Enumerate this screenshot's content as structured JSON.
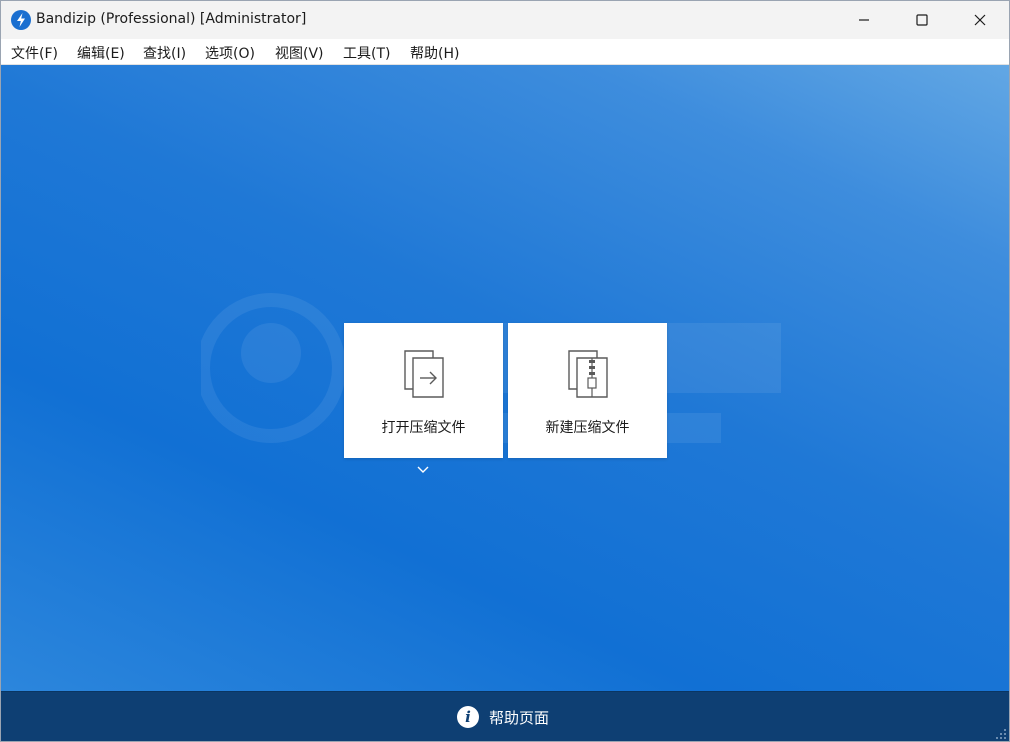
{
  "window": {
    "title": "Bandizip (Professional) [Administrator]",
    "icon": "bandizip-logo-icon"
  },
  "titlebar_controls": {
    "minimize_icon": "minimize-icon",
    "maximize_icon": "maximize-icon",
    "close_icon": "close-icon"
  },
  "menu": {
    "items": [
      {
        "id": "file",
        "label": "文件(F)"
      },
      {
        "id": "edit",
        "label": "编辑(E)"
      },
      {
        "id": "find",
        "label": "查找(I)"
      },
      {
        "id": "options",
        "label": "选项(O)"
      },
      {
        "id": "view",
        "label": "视图(V)"
      },
      {
        "id": "tools",
        "label": "工具(T)"
      },
      {
        "id": "help",
        "label": "帮助(H)"
      }
    ]
  },
  "tiles": {
    "open_archive": {
      "label": "打开压缩文件",
      "icon": "open-archive-icon"
    },
    "new_archive": {
      "label": "新建压缩文件",
      "icon": "zip-file-icon"
    }
  },
  "open_dropdown_icon": "chevron-down-icon",
  "help_bar": {
    "label": "帮助页面",
    "icon": "info-icon",
    "icon_glyph": "i"
  },
  "colors": {
    "content_gradient_start": "#62a7e4",
    "content_gradient_end": "#1170d4",
    "help_bar": "#0e3f73",
    "accent": "#1a6fd0"
  }
}
